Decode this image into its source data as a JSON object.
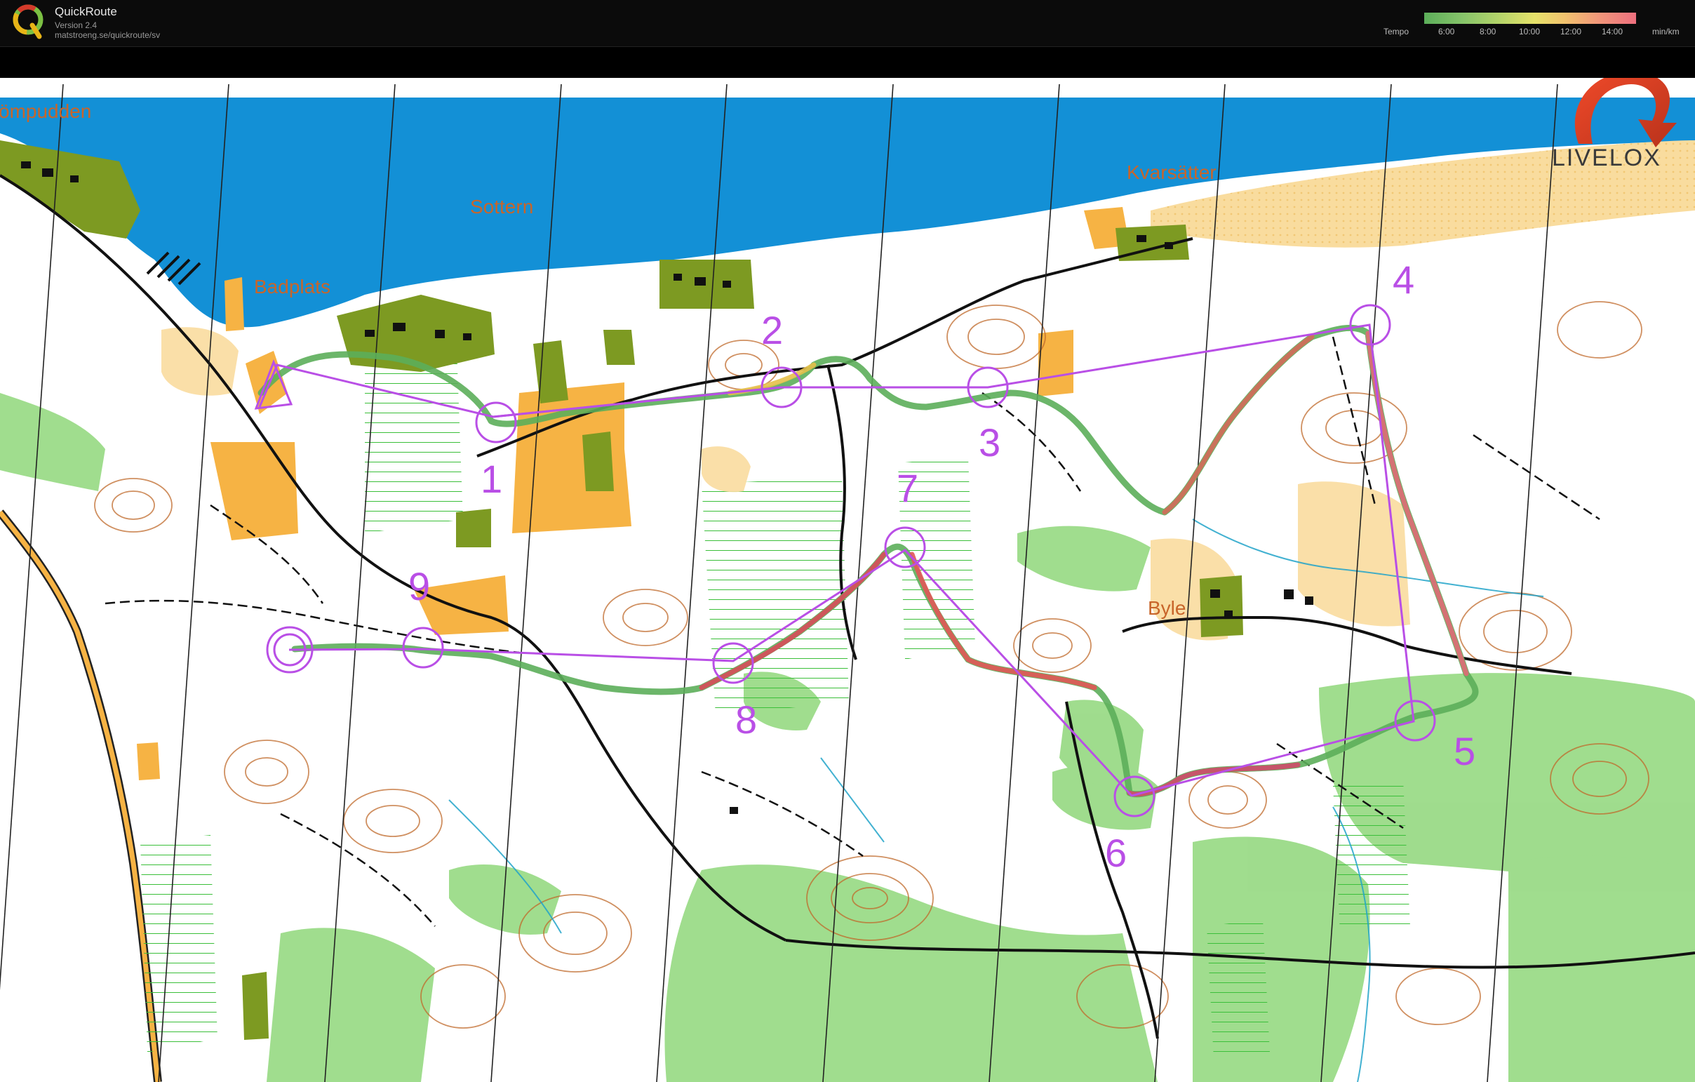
{
  "app": {
    "title": "QuickRoute",
    "version": "Version 2.4",
    "url": "matstroeng.se/quickroute/sv"
  },
  "legend": {
    "label": "Tempo",
    "ticks": [
      "6:00",
      "8:00",
      "10:00",
      "12:00",
      "14:00"
    ],
    "unit": "min/km"
  },
  "map": {
    "place_names": [
      "Badplats",
      "Sottern",
      "Kvarsätter",
      "Byle"
    ],
    "cut_place_name": "ömpudden",
    "watermark": "LIVELOX",
    "controls": [
      "1",
      "2",
      "3",
      "4",
      "5",
      "6",
      "7",
      "8",
      "9"
    ],
    "colors": {
      "water": "#1390d6",
      "forest": "#ffffff",
      "open_land": "#f9dc9e",
      "field": "#f6b344",
      "green": "#8fd77a",
      "course": "#b94fe6",
      "contour": "#c06a2b",
      "place_name": "#c8652a"
    }
  }
}
